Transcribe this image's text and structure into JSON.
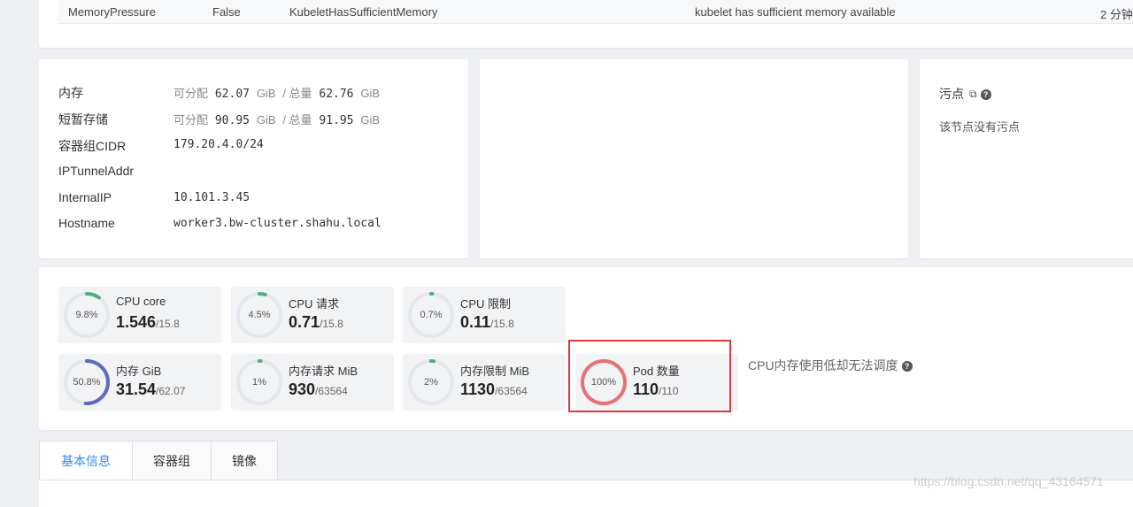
{
  "condition": {
    "type": "MemoryPressure",
    "status": "False",
    "reason": "KubeletHasSufficientMemory",
    "message": "kubelet has sufficient memory available",
    "time": "2 分钟"
  },
  "info": {
    "memory_label": "内存",
    "memory_alloc_prefix": "可分配",
    "memory_alloc": "62.07",
    "unit_gib": "GiB",
    "total_prefix": "/ 总量",
    "memory_total": "62.76",
    "storage_label": "短暂存储",
    "storage_alloc": "90.95",
    "storage_total": "91.95",
    "cidr_label": "容器组CIDR",
    "cidr_value": "179.20.4.0/24",
    "tunnel_label": "IPTunnelAddr",
    "tunnel_value": "",
    "internal_ip_label": "InternalIP",
    "internal_ip_value": "10.101.3.45",
    "hostname_label": "Hostname",
    "hostname_value": "worker3.bw-cluster.shahu.local"
  },
  "taints": {
    "title": "污点",
    "link_icon": "external-link-icon",
    "help_icon": "question-circle-icon",
    "empty": "该节点没有污点"
  },
  "metrics": [
    {
      "title": "CPU core",
      "percent_label": "9.8%",
      "percent": 9.8,
      "used": "1.546",
      "total": "/15.8",
      "color": "#4caf7d"
    },
    {
      "title": "CPU 请求",
      "percent_label": "4.5%",
      "percent": 4.5,
      "used": "0.71",
      "total": "/15.8",
      "color": "#4caf7d"
    },
    {
      "title": "CPU 限制",
      "percent_label": "0.7%",
      "percent": 0.7,
      "used": "0.11",
      "total": "/15.8",
      "color": "#4caf7d"
    },
    {
      "title": "内存 GiB",
      "percent_label": "50.8%",
      "percent": 50.8,
      "used": "31.54",
      "total": "/62.07",
      "color": "#5c6bc0"
    },
    {
      "title": "内存请求 MiB",
      "percent_label": "1%",
      "percent": 1,
      "used": "930",
      "total": "/63564",
      "color": "#4caf7d"
    },
    {
      "title": "内存限制 MiB",
      "percent_label": "2%",
      "percent": 2,
      "used": "1130",
      "total": "/63564",
      "color": "#4caf7d"
    },
    {
      "title": "Pod 数量",
      "percent_label": "100%",
      "percent": 100,
      "used": "110",
      "total": "/110",
      "color": "#e57373"
    }
  ],
  "warning": "CPU内存使用低却无法调度",
  "tabs": [
    "基本信息",
    "容器组",
    "镜像"
  ],
  "watermark": "https://blog.csdn.net/qq_43164571",
  "colors": {
    "accent": "#2d8cf0",
    "highlight": "#e0393e",
    "track": "#e4e7ed"
  }
}
